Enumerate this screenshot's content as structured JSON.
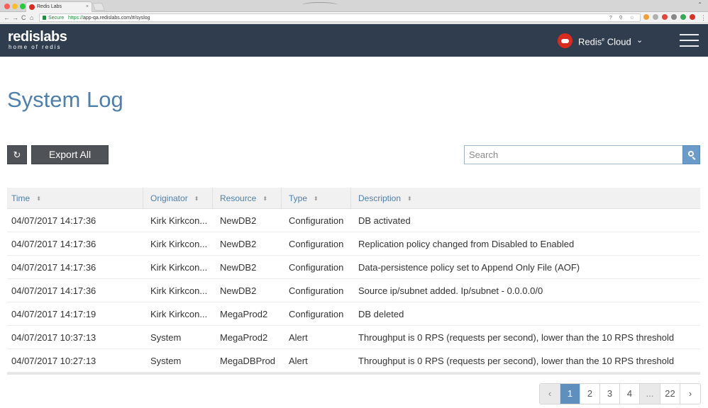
{
  "browser": {
    "tab_title": "Redis Labs",
    "tab_close": "×",
    "secure_label": "Secure",
    "url_protocol": "https://",
    "url_rest": "app-qa.redislabs.com/#/syslog",
    "nav_back": "←",
    "nav_forward": "→",
    "nav_reload": "C",
    "nav_home": "⌂",
    "omnibox_icons": "? ⚲ ☆",
    "window_control": "⌃"
  },
  "header": {
    "logo_main": "redislabs",
    "logo_sub": "home of redis",
    "product_name": "Redis",
    "product_sup": "e",
    "product_suffix": " Cloud",
    "chevron": "⌄"
  },
  "page": {
    "title": "System Log"
  },
  "toolbar": {
    "refresh_glyph": "↻",
    "export_label": "Export All",
    "search_placeholder": "Search"
  },
  "table": {
    "sort_glyph": "⬍",
    "columns": [
      "Time",
      "Originator",
      "Resource",
      "Type",
      "Description"
    ],
    "rows": [
      [
        "04/07/2017  14:17:36",
        "Kirk Kirkcon...",
        "NewDB2",
        "Configuration",
        "DB activated"
      ],
      [
        "04/07/2017  14:17:36",
        "Kirk Kirkcon...",
        "NewDB2",
        "Configuration",
        "Replication policy changed from Disabled to Enabled"
      ],
      [
        "04/07/2017  14:17:36",
        "Kirk Kirkcon...",
        "NewDB2",
        "Configuration",
        "Data-persistence policy set to Append Only File (AOF)"
      ],
      [
        "04/07/2017  14:17:36",
        "Kirk Kirkcon...",
        "NewDB2",
        "Configuration",
        "Source ip/subnet added. Ip/subnet - 0.0.0.0/0"
      ],
      [
        "04/07/2017  14:17:19",
        "Kirk Kirkcon...",
        "MegaProd2",
        "Configuration",
        "DB deleted"
      ],
      [
        "04/07/2017  10:37:13",
        "System",
        "MegaProd2",
        "Alert",
        "Throughput is 0 RPS (requests per second), lower than the 10 RPS threshold"
      ],
      [
        "04/07/2017  10:27:13",
        "System",
        "MegaDBProd",
        "Alert",
        "Throughput is 0 RPS (requests per second), lower than the 10 RPS threshold"
      ]
    ]
  },
  "pagination": {
    "prev": "‹",
    "pages": [
      "1",
      "2",
      "3",
      "4"
    ],
    "ellipsis": "...",
    "last": "22",
    "next": "›",
    "current": "1"
  },
  "colors": {
    "header_bg": "#2f3d4f",
    "title_blue": "#4f7fab",
    "button_dark": "#4f5357",
    "active_page": "#5f8fbd",
    "brand_red": "#d82c20"
  }
}
